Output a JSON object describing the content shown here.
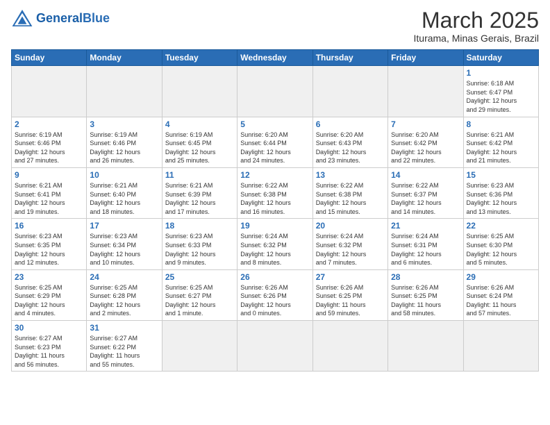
{
  "header": {
    "logo_general": "General",
    "logo_blue": "Blue",
    "month_year": "March 2025",
    "location": "Iturama, Minas Gerais, Brazil"
  },
  "weekdays": [
    "Sunday",
    "Monday",
    "Tuesday",
    "Wednesday",
    "Thursday",
    "Friday",
    "Saturday"
  ],
  "days": {
    "d1": {
      "num": "1",
      "info": "Sunrise: 6:18 AM\nSunset: 6:47 PM\nDaylight: 12 hours\nand 29 minutes."
    },
    "d2": {
      "num": "2",
      "info": "Sunrise: 6:19 AM\nSunset: 6:46 PM\nDaylight: 12 hours\nand 27 minutes."
    },
    "d3": {
      "num": "3",
      "info": "Sunrise: 6:19 AM\nSunset: 6:46 PM\nDaylight: 12 hours\nand 26 minutes."
    },
    "d4": {
      "num": "4",
      "info": "Sunrise: 6:19 AM\nSunset: 6:45 PM\nDaylight: 12 hours\nand 25 minutes."
    },
    "d5": {
      "num": "5",
      "info": "Sunrise: 6:20 AM\nSunset: 6:44 PM\nDaylight: 12 hours\nand 24 minutes."
    },
    "d6": {
      "num": "6",
      "info": "Sunrise: 6:20 AM\nSunset: 6:43 PM\nDaylight: 12 hours\nand 23 minutes."
    },
    "d7": {
      "num": "7",
      "info": "Sunrise: 6:20 AM\nSunset: 6:42 PM\nDaylight: 12 hours\nand 22 minutes."
    },
    "d8": {
      "num": "8",
      "info": "Sunrise: 6:21 AM\nSunset: 6:42 PM\nDaylight: 12 hours\nand 21 minutes."
    },
    "d9": {
      "num": "9",
      "info": "Sunrise: 6:21 AM\nSunset: 6:41 PM\nDaylight: 12 hours\nand 19 minutes."
    },
    "d10": {
      "num": "10",
      "info": "Sunrise: 6:21 AM\nSunset: 6:40 PM\nDaylight: 12 hours\nand 18 minutes."
    },
    "d11": {
      "num": "11",
      "info": "Sunrise: 6:21 AM\nSunset: 6:39 PM\nDaylight: 12 hours\nand 17 minutes."
    },
    "d12": {
      "num": "12",
      "info": "Sunrise: 6:22 AM\nSunset: 6:38 PM\nDaylight: 12 hours\nand 16 minutes."
    },
    "d13": {
      "num": "13",
      "info": "Sunrise: 6:22 AM\nSunset: 6:38 PM\nDaylight: 12 hours\nand 15 minutes."
    },
    "d14": {
      "num": "14",
      "info": "Sunrise: 6:22 AM\nSunset: 6:37 PM\nDaylight: 12 hours\nand 14 minutes."
    },
    "d15": {
      "num": "15",
      "info": "Sunrise: 6:23 AM\nSunset: 6:36 PM\nDaylight: 12 hours\nand 13 minutes."
    },
    "d16": {
      "num": "16",
      "info": "Sunrise: 6:23 AM\nSunset: 6:35 PM\nDaylight: 12 hours\nand 12 minutes."
    },
    "d17": {
      "num": "17",
      "info": "Sunrise: 6:23 AM\nSunset: 6:34 PM\nDaylight: 12 hours\nand 10 minutes."
    },
    "d18": {
      "num": "18",
      "info": "Sunrise: 6:23 AM\nSunset: 6:33 PM\nDaylight: 12 hours\nand 9 minutes."
    },
    "d19": {
      "num": "19",
      "info": "Sunrise: 6:24 AM\nSunset: 6:32 PM\nDaylight: 12 hours\nand 8 minutes."
    },
    "d20": {
      "num": "20",
      "info": "Sunrise: 6:24 AM\nSunset: 6:32 PM\nDaylight: 12 hours\nand 7 minutes."
    },
    "d21": {
      "num": "21",
      "info": "Sunrise: 6:24 AM\nSunset: 6:31 PM\nDaylight: 12 hours\nand 6 minutes."
    },
    "d22": {
      "num": "22",
      "info": "Sunrise: 6:25 AM\nSunset: 6:30 PM\nDaylight: 12 hours\nand 5 minutes."
    },
    "d23": {
      "num": "23",
      "info": "Sunrise: 6:25 AM\nSunset: 6:29 PM\nDaylight: 12 hours\nand 4 minutes."
    },
    "d24": {
      "num": "24",
      "info": "Sunrise: 6:25 AM\nSunset: 6:28 PM\nDaylight: 12 hours\nand 2 minutes."
    },
    "d25": {
      "num": "25",
      "info": "Sunrise: 6:25 AM\nSunset: 6:27 PM\nDaylight: 12 hours\nand 1 minute."
    },
    "d26": {
      "num": "26",
      "info": "Sunrise: 6:26 AM\nSunset: 6:26 PM\nDaylight: 12 hours\nand 0 minutes."
    },
    "d27": {
      "num": "27",
      "info": "Sunrise: 6:26 AM\nSunset: 6:25 PM\nDaylight: 11 hours\nand 59 minutes."
    },
    "d28": {
      "num": "28",
      "info": "Sunrise: 6:26 AM\nSunset: 6:25 PM\nDaylight: 11 hours\nand 58 minutes."
    },
    "d29": {
      "num": "29",
      "info": "Sunrise: 6:26 AM\nSunset: 6:24 PM\nDaylight: 11 hours\nand 57 minutes."
    },
    "d30": {
      "num": "30",
      "info": "Sunrise: 6:27 AM\nSunset: 6:23 PM\nDaylight: 11 hours\nand 56 minutes."
    },
    "d31": {
      "num": "31",
      "info": "Sunrise: 6:27 AM\nSunset: 6:22 PM\nDaylight: 11 hours\nand 55 minutes."
    }
  }
}
